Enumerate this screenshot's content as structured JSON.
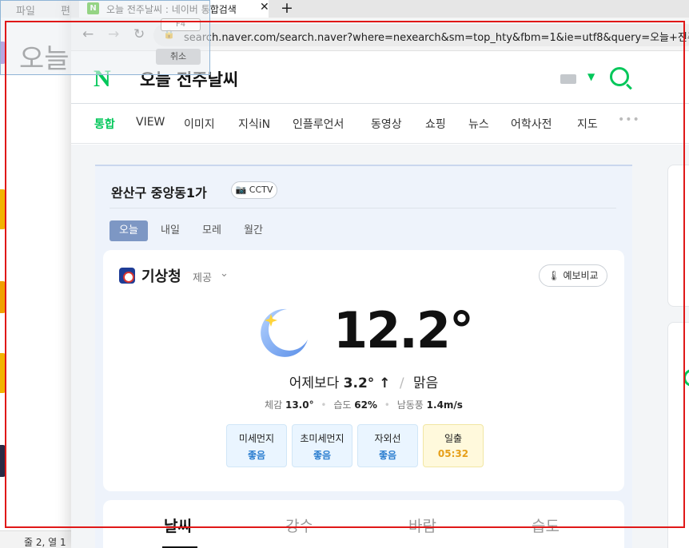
{
  "notepad": {
    "menu_file": "파일",
    "menu_edit": "편",
    "big_text": "오늘",
    "status": "줄 2, 열 1"
  },
  "browser": {
    "tab_title": "오늘 전주날씨 : 네이버 통합검색",
    "url": "search.naver.com/search.naver?where=nexearch&sm=top_hty&fbm=1&ie=utf8&query=오늘+전주날씨",
    "new_tab_glyph": "+",
    "tab_close_glyph": "✕"
  },
  "popup": {
    "key_hint": "F4",
    "cancel_label": "취소"
  },
  "naver": {
    "logo": "N",
    "query": "오늘 전주날씨",
    "nav_tabs": [
      "통합",
      "VIEW",
      "이미지",
      "지식iN",
      "인플루언서",
      "동영상",
      "쇼핑",
      "뉴스",
      "어학사전",
      "지도"
    ],
    "more": "•••"
  },
  "weather": {
    "location": "완산구 중앙동1가",
    "cctv": "CCTV",
    "day_tabs": [
      "오늘",
      "내일",
      "모레",
      "월간"
    ],
    "provider": "기상청",
    "provider_suffix": "제공",
    "compare_button": "예보비교",
    "temperature": "12.2°",
    "compare_text": "어제보다",
    "compare_value": "3.2° ↑",
    "sky": "맑음",
    "feels_label": "체감",
    "feels_value": "13.0°",
    "humidity_label": "습도",
    "humidity_value": "62%",
    "wind_label": "남동풍",
    "wind_value": "1.4m/s",
    "chips": [
      {
        "label": "미세먼지",
        "value": "좋음"
      },
      {
        "label": "초미세먼지",
        "value": "좋음"
      },
      {
        "label": "자외선",
        "value": "좋음"
      },
      {
        "label": "일출",
        "value": "05:32"
      }
    ],
    "sub_tabs": [
      "날씨",
      "강수",
      "바람",
      "습도"
    ]
  },
  "colors": {
    "naver_green": "#03c75a",
    "selection_red": "#e01818",
    "chip_blue": "#2d7fd0",
    "sunrise_orange": "#e69f19"
  }
}
